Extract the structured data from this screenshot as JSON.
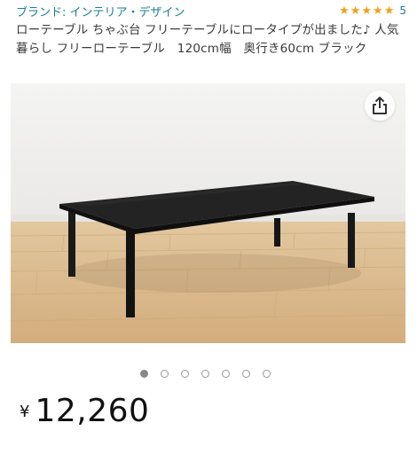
{
  "product": {
    "brand_label": "ブランド: インテリア・デザイン",
    "rating_count": "5",
    "stars": 5,
    "title": "ローテーブル ちゃぶ台 フリーテーブルにロータイプが出ました♪ 人気 暮らし フリーローテーブル　120cm幅　奥行き60cm ブラック",
    "currency_symbol": "¥",
    "price": "12,260"
  },
  "gallery": {
    "image_count": 7,
    "active_index": 0,
    "share_icon": "share-icon"
  },
  "colors": {
    "link": "#1a7f8e",
    "star": "#f0a21a",
    "table": "#1c1c1c"
  }
}
